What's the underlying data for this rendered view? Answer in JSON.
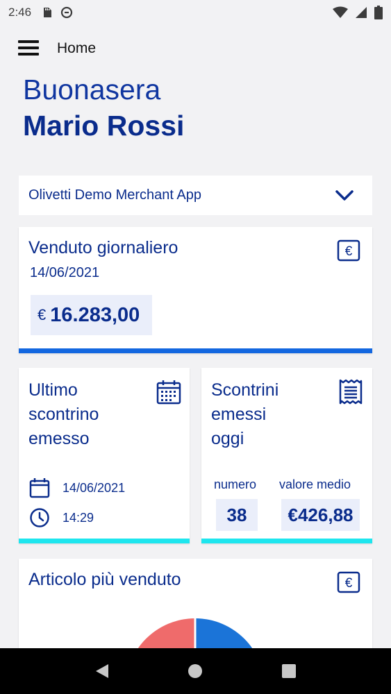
{
  "status_bar": {
    "time": "2:46"
  },
  "app_bar": {
    "title": "Home"
  },
  "greeting": {
    "salutation": "Buonasera",
    "name": "Mario Rossi"
  },
  "merchant_select": {
    "selected": "Olivetti Demo Merchant App"
  },
  "daily_sales": {
    "title": "Venduto giornaliero",
    "date": "14/06/2021",
    "currency": "€",
    "amount": "16.283,00"
  },
  "last_receipt": {
    "title_line1": "Ultimo",
    "title_line2": "scontrino",
    "title_line3": "emesso",
    "date": "14/06/2021",
    "time": "14:29"
  },
  "receipts_today": {
    "title_line1": "Scontrini",
    "title_line2": "emessi",
    "title_line3": "oggi",
    "count_label": "numero",
    "avg_label": "valore medio",
    "count": "38",
    "avg": "€426,88"
  },
  "top_item": {
    "title": "Articolo più venduto"
  },
  "pie_chart": {
    "slices": [
      {
        "color": "#ef6b6b"
      },
      {
        "color": "#1b74d8"
      }
    ]
  },
  "colors": {
    "primary": "#0a2c8c",
    "accent_blue": "#1367e0",
    "accent_cyan": "#1ee6ee",
    "box_bg": "#eaeefa"
  }
}
